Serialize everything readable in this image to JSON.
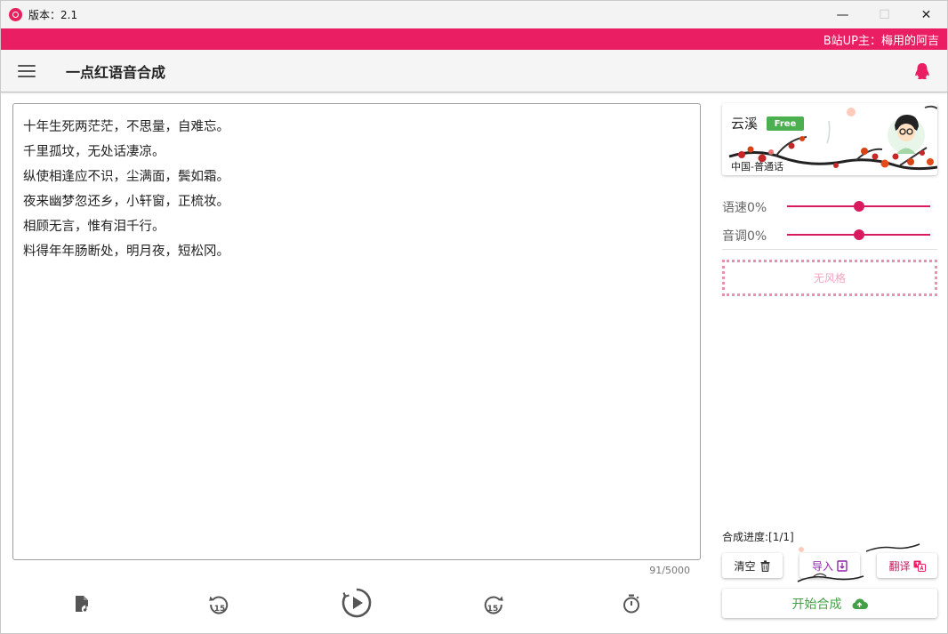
{
  "window": {
    "title": "版本：2.1",
    "minimize_glyph": "—",
    "maximize_glyph": "☐",
    "close_glyph": "✕"
  },
  "banner": {
    "text": "B站UP主：梅用的阿吉"
  },
  "appbar": {
    "title": "一点红语音合成",
    "menu_icon": "hamburger-menu-icon",
    "right_icon": "qq-penguin-icon"
  },
  "editor": {
    "lines": [
      "十年生死两茫茫，不思量，自难忘。",
      "千里孤坟，无处话凄凉。",
      "纵使相逢应不识，尘满面，鬓如霜。",
      "夜来幽梦忽还乡，小轩窗，正梳妆。",
      "相顾无言，惟有泪千行。",
      "料得年年肠断处，明月夜，短松冈。"
    ],
    "char_count": "91/5000"
  },
  "player": {
    "buttons": [
      "audio-file-icon",
      "rewind-15-icon",
      "play-icon",
      "forward-15-icon",
      "timer-icon"
    ],
    "skip_seconds": "15"
  },
  "voice": {
    "name": "云溪",
    "badge": "Free",
    "locale": "中国-普通话"
  },
  "controls": {
    "rate_label": "语速0%",
    "rate_value": 0,
    "pitch_label": "音调0%",
    "pitch_value": 0,
    "style_label": "无风格"
  },
  "progress": {
    "label": "合成进度:[1/1]"
  },
  "actions": {
    "clear_label": "清空",
    "import_label": "导入",
    "translate_label": "翻译",
    "synthesize_label": "开始合成"
  },
  "colors": {
    "accent": "#e91e63",
    "slider": "#d81b60",
    "import": "#8e24aa",
    "synthesize": "#43a047",
    "free_badge": "#4caf50"
  }
}
